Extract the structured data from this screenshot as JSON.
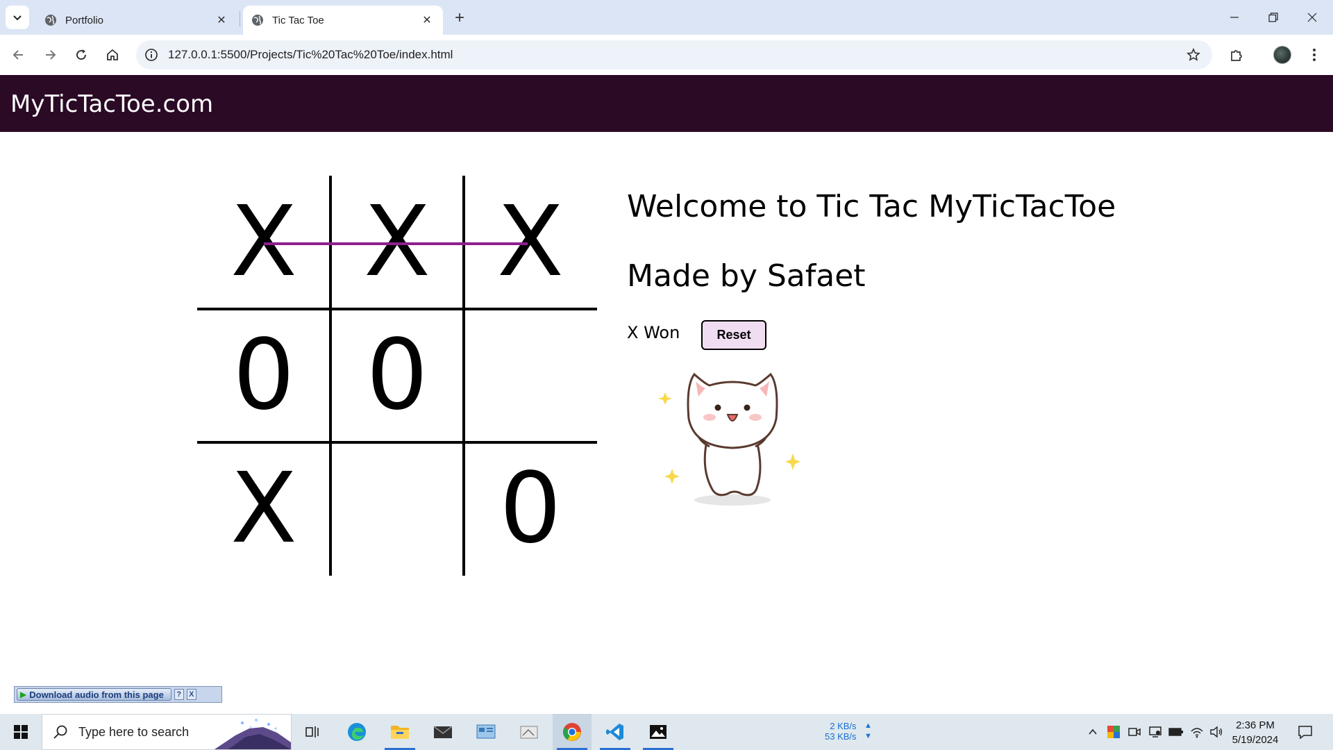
{
  "browser": {
    "tabs": [
      {
        "title": "Portfolio",
        "active": false
      },
      {
        "title": "Tic Tac Toe",
        "active": true
      }
    ],
    "url": "127.0.0.1:5500/Projects/Tic%20Tac%20Toe/index.html"
  },
  "site": {
    "brand": "MyTicTacToe.com"
  },
  "game": {
    "board": [
      "X",
      "X",
      "X",
      "0",
      "0",
      "",
      "X",
      "",
      "0"
    ],
    "winning_line": "top-row",
    "win_line_color": "#8e1f8e",
    "welcome": "Welcome to Tic Tac MyTicTacToe",
    "author": "Made by Safaet",
    "status": "X Won",
    "reset_label": "Reset"
  },
  "widget": {
    "download_label": "Download audio from this page",
    "help_label": "?",
    "close_label": "X"
  },
  "taskbar": {
    "search_placeholder": "Type here to search",
    "net_up": "2 KB/s",
    "net_down": "53 KB/s",
    "time": "2:36 PM",
    "date": "5/19/2024"
  },
  "colors": {
    "nav_background": "#2b0a26",
    "reset_button": "#f1ddf2",
    "tab_strip": "#dbe5f5"
  }
}
